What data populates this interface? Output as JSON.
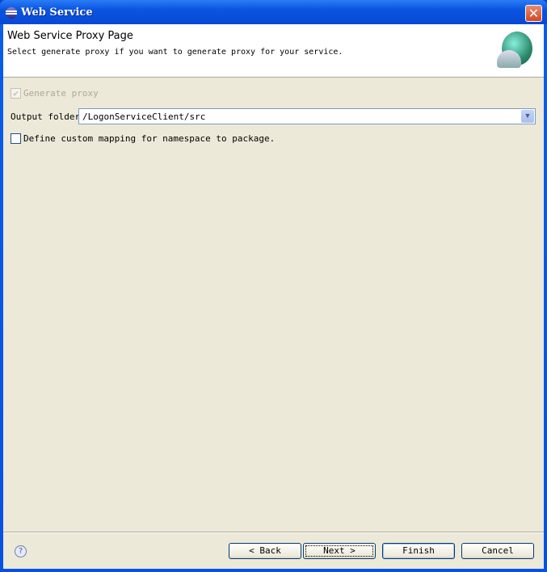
{
  "window": {
    "title": "Web Service",
    "close": "✕"
  },
  "header": {
    "title": "Web Service Proxy Page",
    "description": "Select generate proxy if you want to generate proxy for your service."
  },
  "form": {
    "generate_proxy": {
      "label": "Generate proxy",
      "checked": true,
      "enabled": false
    },
    "output_folder": {
      "label": "Output folder",
      "value": "/LogonServiceClient/src"
    },
    "custom_mapping": {
      "label": "Define custom mapping for namespace to package.",
      "checked": false
    }
  },
  "buttons": {
    "help": "?",
    "back": "< Back",
    "next": "Next >",
    "finish": "Finish",
    "cancel": "Cancel"
  }
}
